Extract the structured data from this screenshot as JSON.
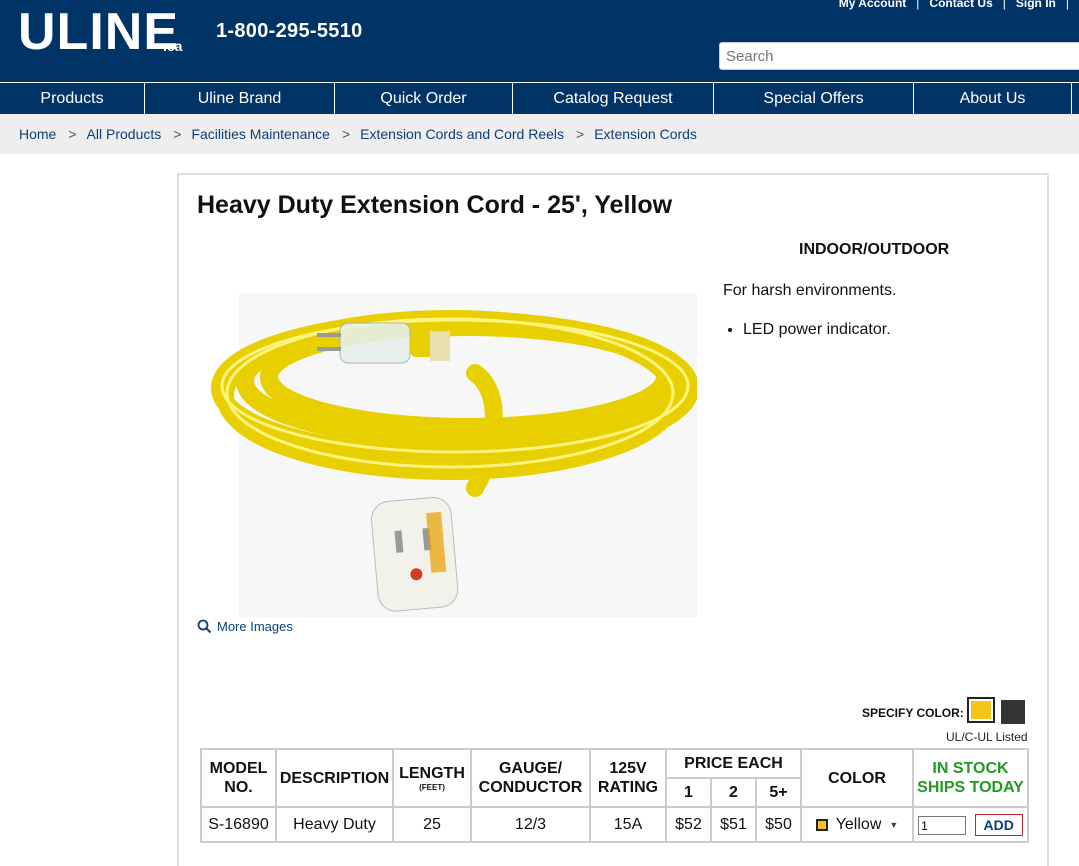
{
  "header": {
    "logo": "ULINE",
    "logo_suffix": ".ca",
    "phone": "1-800-295-5510",
    "top_links": [
      "My Account",
      "Contact Us",
      "Sign In"
    ],
    "search_placeholder": "Search"
  },
  "nav": [
    "Products",
    "Uline Brand",
    "Quick Order",
    "Catalog Request",
    "Special Offers",
    "About Us"
  ],
  "breadcrumb": [
    "Home",
    "All Products",
    "Facilities Maintenance",
    "Extension Cords and Cord Reels",
    "Extension Cords"
  ],
  "product": {
    "title": "Heavy Duty Extension Cord - 25', Yellow",
    "subtitle": "INDOOR/OUTDOOR",
    "description": "For harsh environments.",
    "bullets": [
      "LED power indicator."
    ],
    "more_images": "More Images",
    "specify_color": "SPECIFY COLOR:",
    "listing": "UL/C-UL Listed",
    "colors": {
      "yellow": "#f5c518",
      "black": "#333333",
      "brand_navy": "#003366"
    }
  },
  "table": {
    "headers": {
      "model": "MODEL NO.",
      "description": "DESCRIPTION",
      "length": "LENGTH",
      "length_unit": "(FEET)",
      "gauge": "GAUGE/ CONDUCTOR",
      "rating": "125V RATING",
      "price_each": "PRICE EACH",
      "price_tiers": [
        "1",
        "2",
        "5+"
      ],
      "color": "COLOR",
      "stock": "IN STOCK SHIPS TODAY"
    },
    "row": {
      "model": "S-16890",
      "description": "Heavy Duty",
      "length": "25",
      "gauge": "12/3",
      "rating": "15A",
      "prices": [
        "$52",
        "$51",
        "$50"
      ],
      "color": "Yellow",
      "qty": "1",
      "add": "ADD"
    }
  }
}
